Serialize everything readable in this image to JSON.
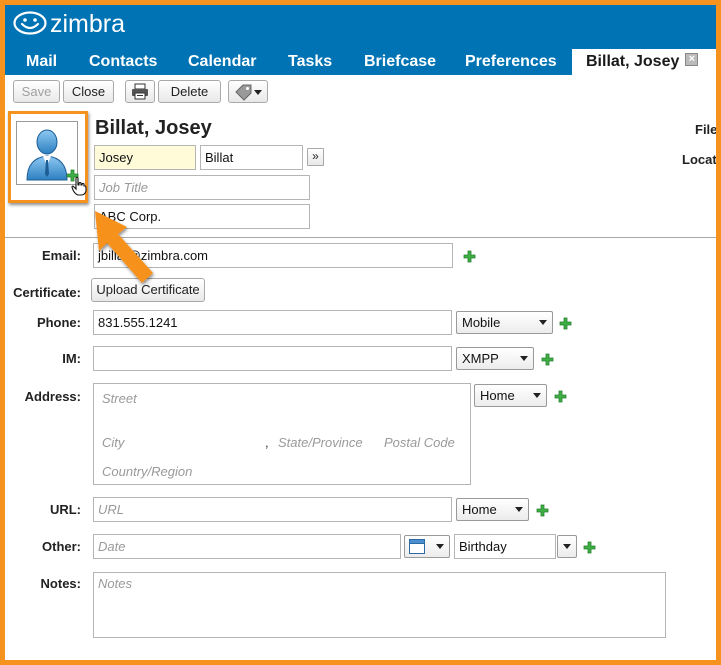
{
  "app": {
    "brand": "zimbra"
  },
  "tabs": [
    {
      "label": "Mail"
    },
    {
      "label": "Contacts"
    },
    {
      "label": "Calendar"
    },
    {
      "label": "Tasks"
    },
    {
      "label": "Briefcase"
    },
    {
      "label": "Preferences"
    }
  ],
  "active_tab": {
    "label": "Billat, Josey",
    "close_glyph": "×"
  },
  "toolbar": {
    "save_label": "Save",
    "close_label": "Close",
    "delete_label": "Delete"
  },
  "contact": {
    "display_name": "Billat, Josey",
    "first_name": "Josey",
    "last_name": "Billat",
    "more_glyph": "»",
    "job_title_placeholder": "Job Title",
    "company": "ABC Corp."
  },
  "right": {
    "file_label": "File",
    "location_label": "Locati"
  },
  "labels": {
    "email": "Email:",
    "certificate": "Certificate:",
    "phone": "Phone:",
    "im": "IM:",
    "address": "Address:",
    "url": "URL:",
    "other": "Other:",
    "notes": "Notes:"
  },
  "fields": {
    "email": "jbillat@zimbra.com",
    "upload_certificate": "Upload Certificate",
    "phone": "831.555.1241",
    "phone_type": "Mobile",
    "im": "",
    "im_type": "XMPP",
    "address_type": "Home",
    "street_placeholder": "Street",
    "city_placeholder": "City",
    "comma": ",",
    "state_placeholder": "State/Province",
    "postal_placeholder": "Postal Code",
    "country_placeholder": "Country/Region",
    "url_placeholder": "URL",
    "url_type": "Home",
    "date_placeholder": "Date",
    "other_type": "Birthday",
    "notes_placeholder": "Notes"
  },
  "colors": {
    "brand_blue": "#0073b4",
    "accent_orange": "#f6921e",
    "plus_green": "#3cb043"
  },
  "icons": {
    "logo": "smiley-logo-icon",
    "print": "printer-icon",
    "tag": "tag-icon",
    "photo": "person-avatar-icon",
    "add": "plus-icon",
    "calendar": "calendar-icon",
    "cursor": "hand-pointer-icon"
  }
}
